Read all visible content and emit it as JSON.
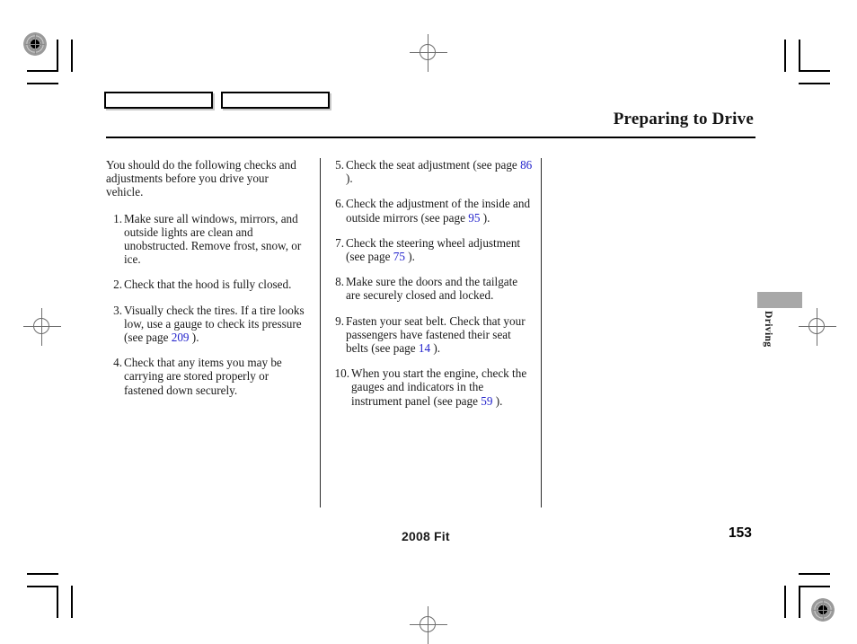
{
  "header": {
    "title": "Preparing to Drive"
  },
  "content": {
    "intro": "You should do the following checks and adjustments before you drive your vehicle.",
    "left_items": [
      {
        "number": "1.",
        "text_before": "Make sure all windows, mirrors, and outside lights are clean and unobstructed. Remove frost, snow, or ice.",
        "page_ref": "",
        "text_after": ""
      },
      {
        "number": "2.",
        "text_before": "Check that the hood is fully closed.",
        "page_ref": "",
        "text_after": ""
      },
      {
        "number": "3.",
        "text_before": "Visually check the tires. If a tire looks low, use a gauge to check its pressure (see page",
        "page_ref": "209",
        "text_after": ")."
      },
      {
        "number": "4.",
        "text_before": "Check that any items you may be carrying are stored properly or fastened down securely.",
        "page_ref": "",
        "text_after": ""
      }
    ],
    "right_items": [
      {
        "number": "5.",
        "text_before": "Check the seat adjustment (see page",
        "page_ref": "86",
        "text_after": ")."
      },
      {
        "number": "6.",
        "text_before": "Check the adjustment of the inside and outside mirrors (see page",
        "page_ref": "95",
        "text_after": ")."
      },
      {
        "number": "7.",
        "text_before": "Check the steering wheel adjustment (see page",
        "page_ref": "75",
        "text_after": ")."
      },
      {
        "number": "8.",
        "text_before": "Make sure the doors and the tailgate are securely closed and locked.",
        "page_ref": "",
        "text_after": ""
      },
      {
        "number": "9.",
        "text_before": "Fasten your seat belt. Check that your passengers have fastened their seat belts (see page",
        "page_ref": "14",
        "text_after": ")."
      },
      {
        "number": "10.",
        "text_before": "When you start the engine, check the gauges and indicators in the instrument panel (see page",
        "page_ref": "59",
        "text_after": ")."
      }
    ]
  },
  "side_tab": {
    "label": "Driving",
    "color": "#a8a8a8"
  },
  "footer": {
    "model_year": "2008  Fit",
    "page_number": "153"
  },
  "colors": {
    "page_reference": "#2222cc",
    "rule": "#000000",
    "text": "#1a1a1a"
  }
}
